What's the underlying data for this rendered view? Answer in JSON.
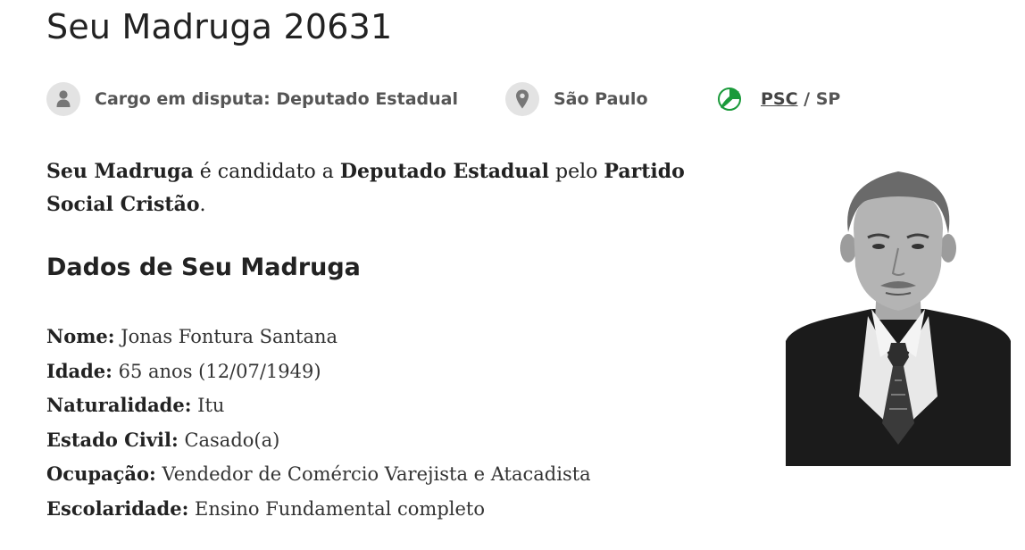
{
  "candidate": {
    "title": "Seu Madruga 20631",
    "nickname": "Seu Madruga",
    "photo_alt": "Foto de Seu Madruga"
  },
  "meta": {
    "cargo": {
      "icon": "person-icon",
      "text": "Cargo em disputa: Deputado Estadual"
    },
    "location": {
      "icon": "map-pin-icon",
      "text": "São Paulo"
    },
    "party": {
      "icon": "party-logo-icon",
      "abbr": "PSC",
      "separator": " / ",
      "state": "SP",
      "logo_color": "#1a9a3a"
    }
  },
  "intro": {
    "name": "Seu Madruga",
    "text1": " é candidato a ",
    "office": "Deputado Estadual",
    "text2": " pelo ",
    "party": "Partido Social Cristão",
    "end": "."
  },
  "section": {
    "title": "Dados de Seu Madruga"
  },
  "details": [
    {
      "label": "Nome:",
      "value": "Jonas Fontura Santana"
    },
    {
      "label": "Idade:",
      "value": "65 anos (12/07/1949)"
    },
    {
      "label": "Naturalidade:",
      "value": "Itu"
    },
    {
      "label": "Estado Civil:",
      "value": "Casado(a)"
    },
    {
      "label": "Ocupação:",
      "value": "Vendedor de Comércio Varejista e Atacadista"
    },
    {
      "label": "Escolaridade:",
      "value": "Ensino Fundamental completo"
    }
  ]
}
